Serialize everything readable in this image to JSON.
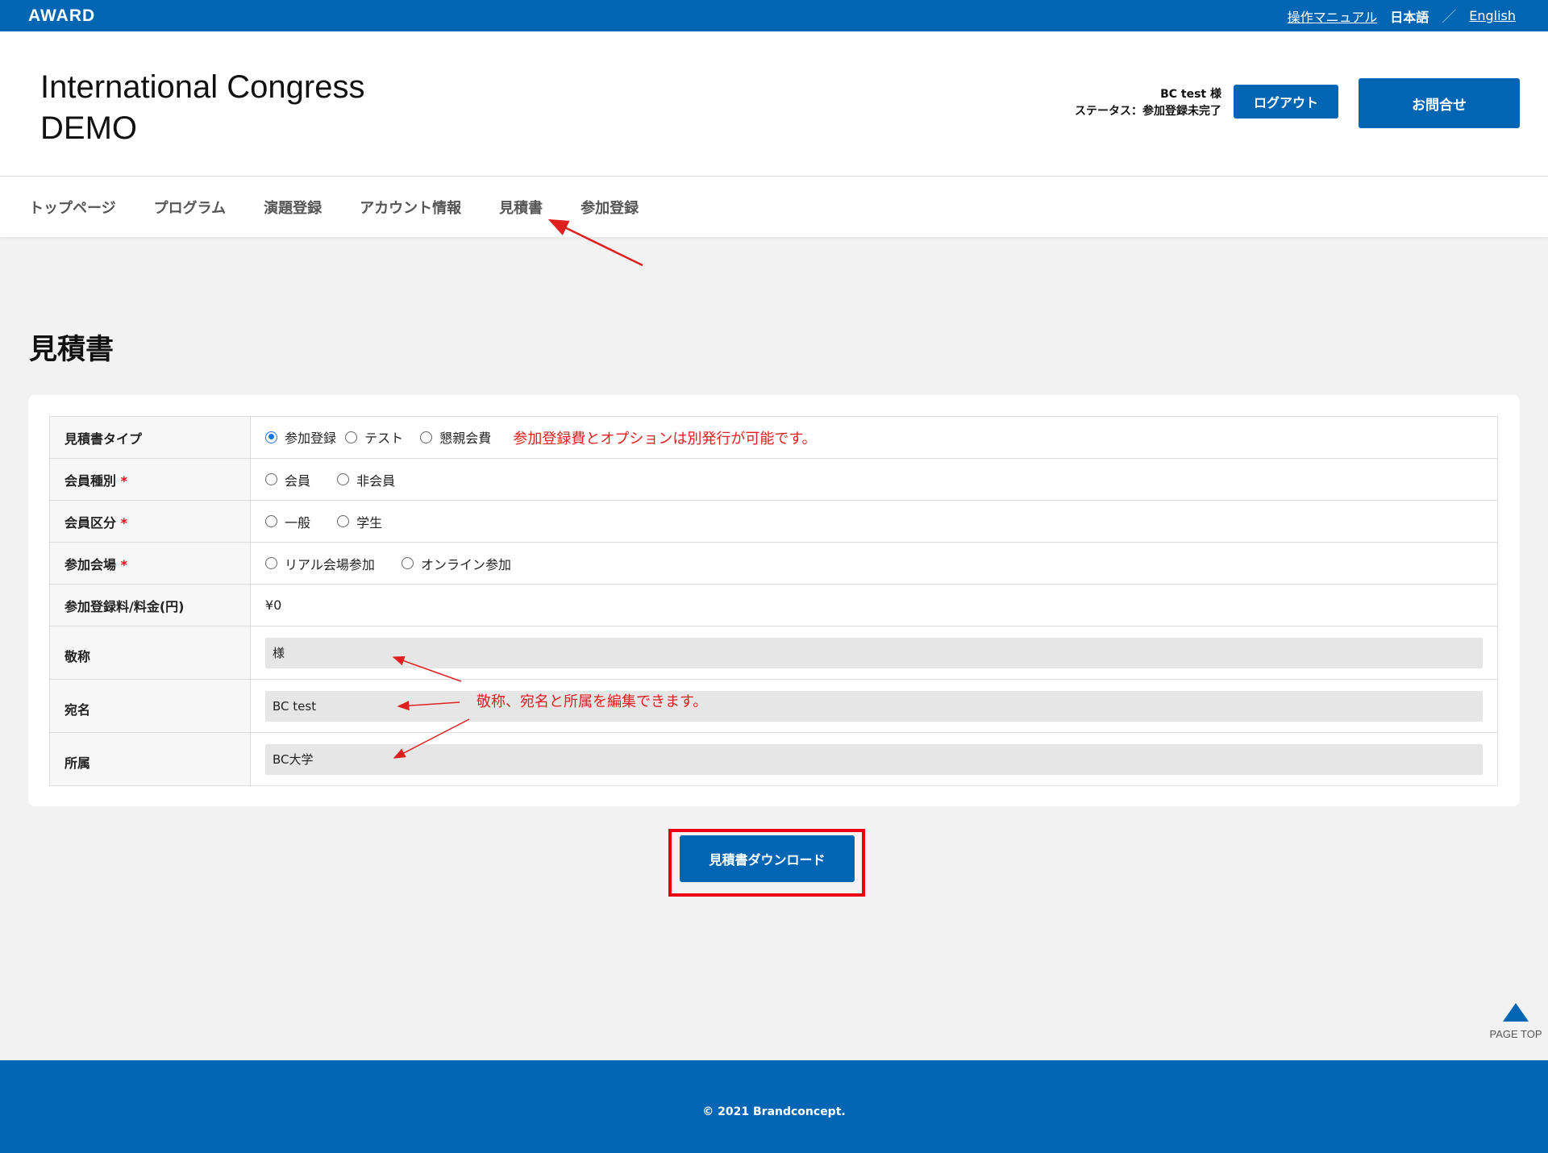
{
  "topbar": {
    "logo": "AWARD",
    "manual_link": "操作マニュアル",
    "lang_ja": "日本語",
    "lang_sep": "／",
    "lang_en": "English"
  },
  "header": {
    "title_line1": "International Congress",
    "title_line2": "DEMO",
    "user_name": "BC test 様",
    "user_status": "ステータス：参加登録未完了",
    "logout_label": "ログアウト",
    "contact_label": "お問合せ"
  },
  "nav": {
    "items": [
      "トップページ",
      "プログラム",
      "演題登録",
      "アカウント情報",
      "見積書",
      "参加登録"
    ]
  },
  "page": {
    "heading": "見積書"
  },
  "form": {
    "quote_type": {
      "label": "見積書タイプ",
      "options": [
        "参加登録",
        "テスト",
        "懇親会費"
      ],
      "selected": "参加登録"
    },
    "member_type": {
      "label": "会員種別",
      "required_mark": "*",
      "options": [
        "会員",
        "非会員"
      ]
    },
    "member_class": {
      "label": "会員区分",
      "required_mark": "*",
      "options": [
        "一般",
        "学生"
      ]
    },
    "venue": {
      "label": "参加会場",
      "required_mark": "*",
      "options": [
        "リアル会場参加",
        "オンライン参加"
      ]
    },
    "fee": {
      "label": "参加登録料/料金(円)",
      "value": "¥0"
    },
    "honorific": {
      "label": "敬称",
      "value": "様"
    },
    "addressee": {
      "label": "宛名",
      "value": "BC test"
    },
    "affiliation": {
      "label": "所属",
      "value": "BC大学"
    }
  },
  "annotations": {
    "note1": "参加登録費とオプションは別発行が可能です。",
    "note2": "敬称、宛名と所属を編集できます。",
    "color": "#e02020"
  },
  "actions": {
    "download_label": "見積書ダウンロード"
  },
  "pagetop": {
    "label": "PAGE TOP"
  },
  "footer": {
    "copyright": "© 2021 Brandconcept."
  },
  "colors": {
    "brand": "#0066b3",
    "highlight": "#e60012",
    "background": "#f2f2f2"
  }
}
